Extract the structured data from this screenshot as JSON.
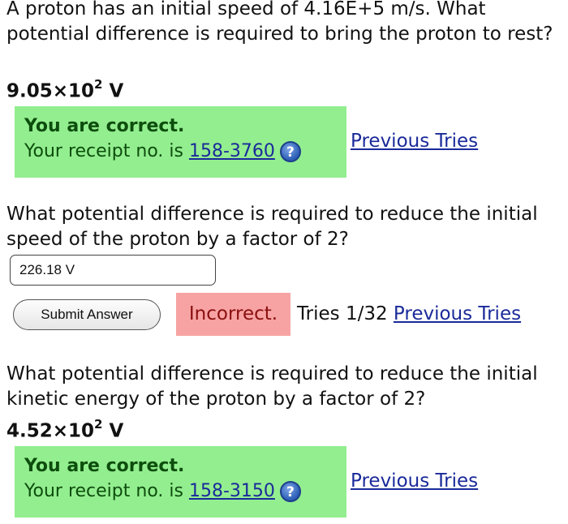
{
  "q1": {
    "question": "A proton has an initial speed of 4.16E+5 m/s. What potential difference is required to bring the proton to rest?",
    "answer_mantissa": "9.05",
    "answer_times": "×10",
    "answer_exp": "2",
    "answer_unit": " V",
    "status": "You are correct.",
    "receipt_prefix": "Your receipt no. is ",
    "receipt_no": "158-3760",
    "help_icon": "?",
    "previous_tries": "Previous Tries"
  },
  "q2": {
    "question": "What potential difference is required to reduce the initial speed of the proton by a factor of 2?",
    "input_value": "226.18 V",
    "submit_label": "Submit Answer",
    "status": "Incorrect.",
    "tries": "Tries 1/32",
    "previous_tries": "Previous Tries"
  },
  "q3": {
    "question": "What potential difference is required to reduce the initial kinetic energy of the proton by a factor of 2?",
    "answer_mantissa": "4.52",
    "answer_times": "×10",
    "answer_exp": "2",
    "answer_unit": " V",
    "status": "You are correct.",
    "receipt_prefix": "Your receipt no. is ",
    "receipt_no": "158-3150",
    "help_icon": "?",
    "previous_tries": "Previous Tries"
  },
  "colors": {
    "correct_bg": "#93ee8f",
    "incorrect_bg": "#f7a3a3",
    "link": "#1a2a9a"
  }
}
